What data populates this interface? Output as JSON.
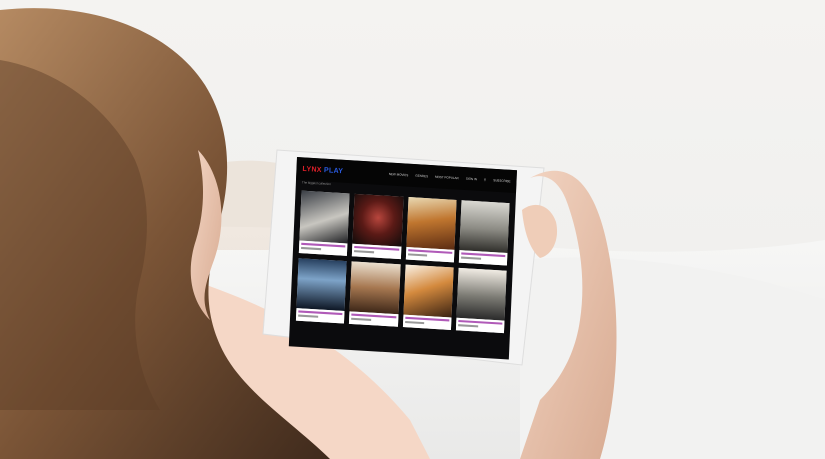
{
  "scene": {
    "description_free": true
  },
  "tablet": {
    "logo_left": "LYNX",
    "logo_right": "PLAY",
    "nav_items": [
      "NEW MOVIES",
      "GENRES",
      "MOST POPULAR",
      "SIGN IN",
      "SUBSCRIBE"
    ],
    "subtitle": "The biggest collection",
    "posters": [
      {
        "id": "poster-1",
        "caption": ""
      },
      {
        "id": "poster-2",
        "caption": ""
      },
      {
        "id": "poster-3",
        "caption": ""
      },
      {
        "id": "poster-4",
        "caption": "LEO REVENANT"
      },
      {
        "id": "poster-5",
        "caption": "CARGO"
      },
      {
        "id": "poster-6",
        "caption": ""
      },
      {
        "id": "poster-7",
        "caption": ""
      },
      {
        "id": "poster-8",
        "caption": "Death Games"
      }
    ]
  },
  "colors": {
    "logo_red": "#e0202a",
    "logo_blue": "#2a5be0",
    "screen_bg": "#0b0b0d"
  }
}
